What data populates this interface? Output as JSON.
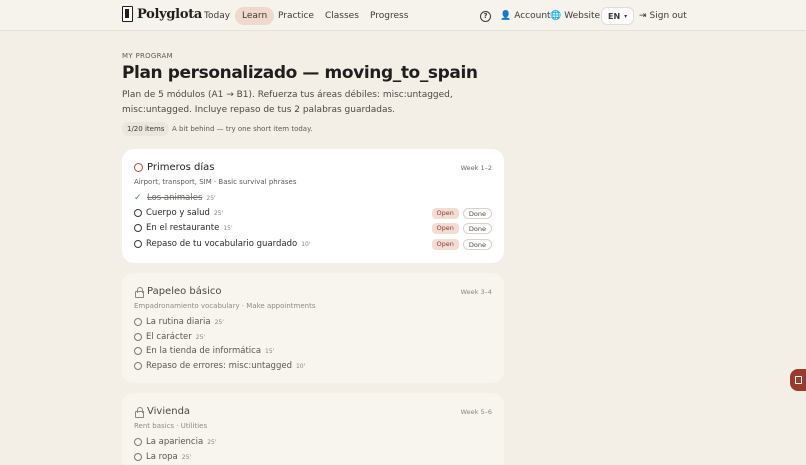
{
  "brand": {
    "name": "Polyglota"
  },
  "nav": {
    "items": [
      {
        "label": "Today",
        "active": false
      },
      {
        "label": "Learn",
        "active": true
      },
      {
        "label": "Practice",
        "active": false
      },
      {
        "label": "Classes",
        "active": false
      },
      {
        "label": "Progress",
        "active": false
      }
    ],
    "account_label": "Account",
    "website_label": "Website",
    "language": "EN",
    "signout_label": "Sign out"
  },
  "program": {
    "eyebrow": "MY PROGRAM",
    "title": "Plan personalizado — moving_to_spain",
    "description": "Plan de 5 módulos (A1 → B1). Refuerza tus áreas débiles: misc:untagged, misc:untagged. Incluye repaso de tus 2 palabras guardadas.",
    "progress_pill": "1/20 items",
    "status_note": "A bit behind — try one short item today."
  },
  "modules": [
    {
      "title": "Primeros días",
      "week": "Week 1–2",
      "subtitle": "Airport, transport, SIM · Basic survival phrases",
      "locked": false,
      "lessons": [
        {
          "name": "Los animales",
          "minutes": "25'",
          "done": true
        },
        {
          "name": "Cuerpo y salud",
          "minutes": "25'",
          "open_label": "Open",
          "done_label": "Done"
        },
        {
          "name": "En el restaurante",
          "minutes": "15'",
          "open_label": "Open",
          "done_label": "Done"
        },
        {
          "name": "Repaso de tu vocabulario guardado",
          "minutes": "10'",
          "open_label": "Open",
          "done_label": "Done"
        }
      ]
    },
    {
      "title": "Papeleo básico",
      "week": "Week 3–4",
      "subtitle": "Empadronamiento vocabulary · Make appointments",
      "locked": true,
      "lessons": [
        {
          "name": "La rutina diaria",
          "minutes": "25'"
        },
        {
          "name": "El carácter",
          "minutes": "25'"
        },
        {
          "name": "En la tienda de informática",
          "minutes": "15'"
        },
        {
          "name": "Repaso de errores: misc:untagged",
          "minutes": "10'"
        }
      ]
    },
    {
      "title": "Vivienda",
      "week": "Week 5–6",
      "subtitle": "Rent basics · Utilities",
      "locked": true,
      "lessons": [
        {
          "name": "La apariencia",
          "minutes": "25'"
        },
        {
          "name": "La ropa",
          "minutes": "25'"
        }
      ]
    }
  ],
  "colors": {
    "accent": "#b5473a",
    "background": "#f3efe7",
    "done_check": "#3a9a5b"
  }
}
